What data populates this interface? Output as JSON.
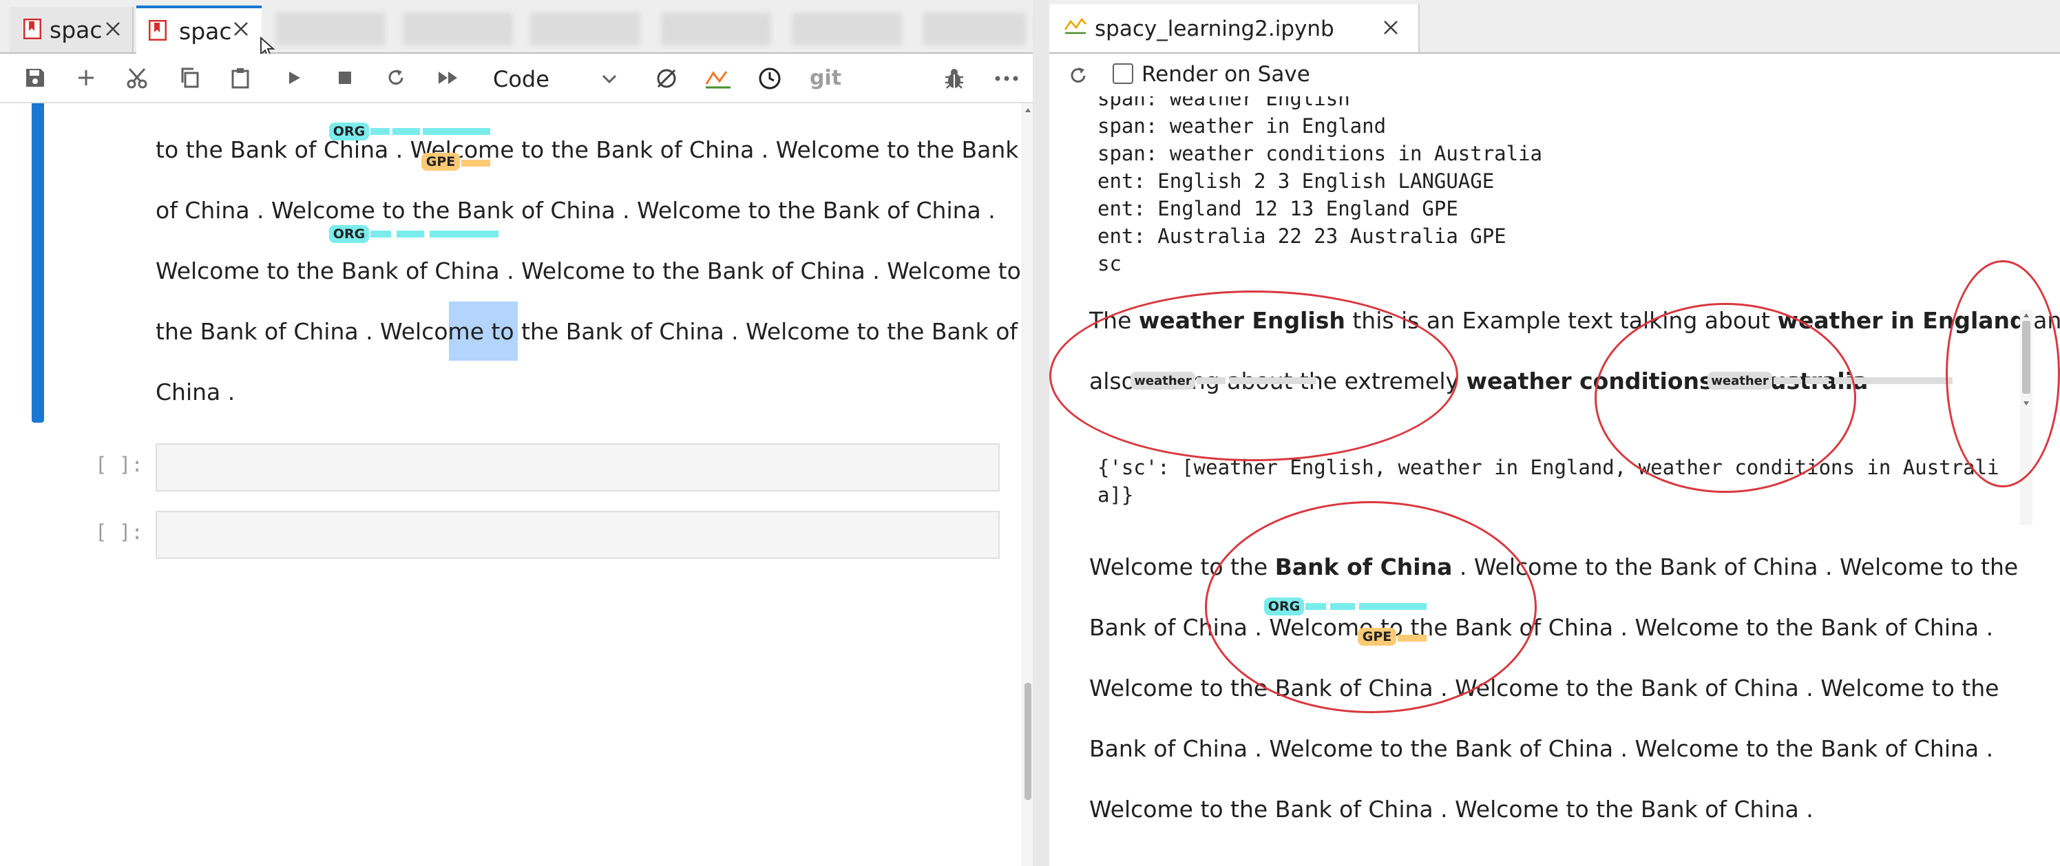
{
  "left_pane": {
    "tabs": [
      {
        "label": "spac",
        "active": false
      },
      {
        "label": "spac",
        "active": true
      }
    ],
    "toolbar": {
      "cell_type": "Code",
      "git_label": "git",
      "icons": [
        "save-icon",
        "add-icon",
        "cut-icon",
        "copy-icon",
        "paste-icon",
        "run-icon",
        "stop-icon",
        "restart-icon",
        "fast-forward-icon",
        "refresh-kernel-icon",
        "activity-icon",
        "clock-icon",
        "git-icon",
        "bug-icon",
        "more-icon"
      ]
    },
    "displacy": {
      "lines": [
        "to the Bank of China . Welcome to the Bank of China . Welcome to the Bank",
        "of China . Welcome to the Bank of China . Welcome to the Bank of China .",
        "Welcome to the Bank of China . Welcome to the Bank of China . Welcome to",
        "the Bank of China . Welcome to the Bank of China . Welcome to the Bank of",
        "China ."
      ],
      "labels": {
        "org": "ORG",
        "gpe": "GPE"
      }
    },
    "cells": [
      {
        "prompt": "[ ]:"
      },
      {
        "prompt": "[ ]:"
      }
    ]
  },
  "right_pane": {
    "tab": {
      "title": "spacy_learning2.ipynb"
    },
    "toolbar": {
      "render_on_save": "Render on Save"
    },
    "output_lines": [
      "span: weather English",
      "span: weather in England",
      "span: weather conditions in Australia",
      "ent: English 2 3 English LANGUAGE",
      "ent: England 12 13 England GPE",
      "ent: Australia 22 23 Australia GPE",
      "sc"
    ],
    "span_viz": {
      "line1": {
        "t1": "The ",
        "b1": "weather English",
        "t2": " this is an Example text talking about ",
        "b2": "weather in England",
        "t3": " and"
      },
      "line2": {
        "t1": "also talking about the extremely ",
        "b1": "weather conditions in Australia"
      },
      "label": "weather"
    },
    "dict_output": [
      "{'sc': [weather English, weather in England, weather conditions in Australi",
      "a]}"
    ],
    "displacy": {
      "line1": {
        "t1": "Welcome to the ",
        "b1": "Bank of China",
        "t2": " . Welcome to the Bank of China . Welcome to the"
      },
      "lines": [
        "Bank of China . Welcome to the Bank of China . Welcome to the Bank of China .",
        "Welcome to the Bank of China . Welcome to the Bank of China . Welcome to the",
        "Bank of China . Welcome to the Bank of China . Welcome to the Bank of China .",
        "Welcome to the Bank of China . Welcome to the Bank of China ."
      ],
      "labels": {
        "org": "ORG",
        "gpe": "GPE"
      }
    }
  },
  "colors": {
    "org_tag": "#7aecec",
    "gpe_tag": "#feca74",
    "span_bar": "#dddddd",
    "cell_bar": "#1976d2",
    "highlight": "#b3d4fc",
    "annotation": "#d9383f",
    "jupyter_orange": "#f37726"
  }
}
